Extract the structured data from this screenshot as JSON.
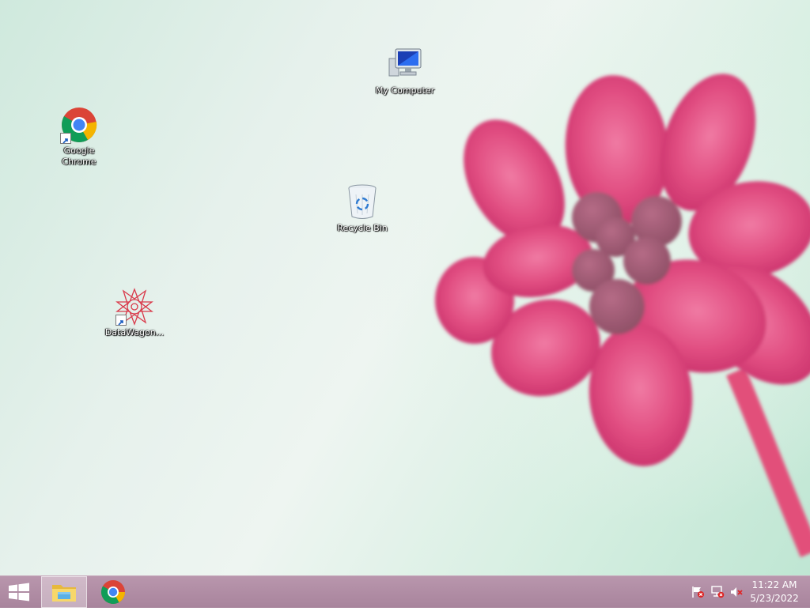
{
  "desktop": {
    "icons": [
      {
        "label": "My Computer",
        "icon": "my-computer-icon"
      },
      {
        "label": "Google Chrome",
        "icon": "google-chrome-icon"
      },
      {
        "label": "Recycle Bin",
        "icon": "recycle-bin-icon"
      },
      {
        "label": "DataWagon...",
        "icon": "datawagon-icon"
      }
    ],
    "wallpaper": {
      "subject": "pink flower",
      "accent": "#e0507f",
      "background": "#d6ede2"
    }
  },
  "taskbar": {
    "start": {
      "icon": "windows-start-icon"
    },
    "pinned": [
      {
        "name": "File Explorer",
        "icon": "file-explorer-icon",
        "active": true
      },
      {
        "name": "Google Chrome",
        "icon": "chrome-icon",
        "active": false
      }
    ],
    "tray": [
      {
        "icon": "action-center-flag-icon"
      },
      {
        "icon": "network-icon"
      },
      {
        "icon": "volume-muted-icon"
      }
    ],
    "clock": {
      "time": "11:22 AM",
      "date": "5/23/2022"
    },
    "color": "#a8849c"
  }
}
